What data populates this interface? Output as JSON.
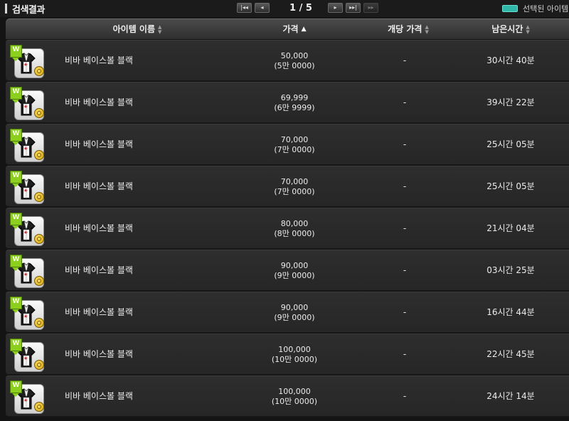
{
  "header": {
    "title": "검색결과"
  },
  "pagination": {
    "first_label": "|◂◂",
    "prev_label": "◂",
    "page_text": "1 / 5",
    "next_label": "▸",
    "next_block_label": "▸▸|",
    "last_label": "▸▸"
  },
  "legend": {
    "color": "#2fb7a8",
    "label": "선택된 아이템"
  },
  "columns": {
    "name": "아이템 이름",
    "price": "가격",
    "unit_price": "개당 가격",
    "time_left": "남은시간"
  },
  "sort": {
    "column": "price",
    "direction": "ascending"
  },
  "icons": {
    "item": "baseball-shirt-icon",
    "badge": "w-badge-icon",
    "coin": "coin-icon",
    "sort_both": "sort-updown-icon",
    "sort_asc": "sort-asc-icon"
  },
  "rows": [
    {
      "name": "비바 베이스볼 블랙",
      "price": "50,000",
      "price_kr": "(5만 0000)",
      "unit_price": "-",
      "time_left": "30시간 40분"
    },
    {
      "name": "비바 베이스볼 블랙",
      "price": "69,999",
      "price_kr": "(6만 9999)",
      "unit_price": "-",
      "time_left": "39시간 22분"
    },
    {
      "name": "비바 베이스볼 블랙",
      "price": "70,000",
      "price_kr": "(7만 0000)",
      "unit_price": "-",
      "time_left": "25시간 05분"
    },
    {
      "name": "비바 베이스볼 블랙",
      "price": "70,000",
      "price_kr": "(7만 0000)",
      "unit_price": "-",
      "time_left": "25시간 05분"
    },
    {
      "name": "비바 베이스볼 블랙",
      "price": "80,000",
      "price_kr": "(8만 0000)",
      "unit_price": "-",
      "time_left": "21시간 04분"
    },
    {
      "name": "비바 베이스볼 블랙",
      "price": "90,000",
      "price_kr": "(9만 0000)",
      "unit_price": "-",
      "time_left": "03시간 25분"
    },
    {
      "name": "비바 베이스볼 블랙",
      "price": "90,000",
      "price_kr": "(9만 0000)",
      "unit_price": "-",
      "time_left": "16시간 44분"
    },
    {
      "name": "비바 베이스볼 블랙",
      "price": "100,000",
      "price_kr": "(10만 0000)",
      "unit_price": "-",
      "time_left": "22시간 45분"
    },
    {
      "name": "비바 베이스볼 블랙",
      "price": "100,000",
      "price_kr": "(10만 0000)",
      "unit_price": "-",
      "time_left": "24시간 14분"
    }
  ]
}
